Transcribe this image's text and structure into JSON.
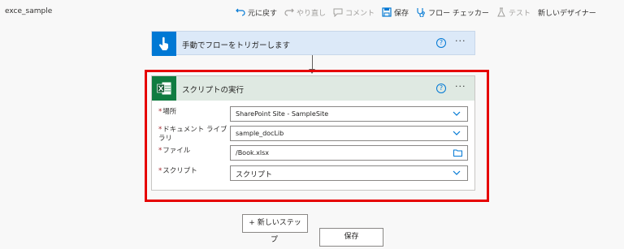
{
  "app": {
    "title": "exce_sample"
  },
  "toolbar": {
    "undo": "元に戻す",
    "redo": "やり直し",
    "comment": "コメント",
    "save": "保存",
    "flow_checker": "フロー チェッカー",
    "test": "テスト",
    "new_designer": "新しいデザイナー"
  },
  "trigger": {
    "title": "手動でフローをトリガーします"
  },
  "action": {
    "title": "スクリプトの実行",
    "fields": [
      {
        "label": "場所",
        "value": "SharePoint Site - SampleSite"
      },
      {
        "label_line1": "ドキュメント ライブ",
        "label_line2": "ラリ",
        "value": "sample_docLib"
      },
      {
        "label": "ファイル",
        "value": "/Book.xlsx"
      },
      {
        "label": "スクリプト",
        "value": "スクリプト"
      }
    ]
  },
  "buttons": {
    "new_step_line1": "+ 新しいステッ",
    "new_step_line2": "プ",
    "save": "保存"
  },
  "colors": {
    "accent": "#0078d4",
    "excel": "#107c41",
    "highlight": "#e60000"
  }
}
